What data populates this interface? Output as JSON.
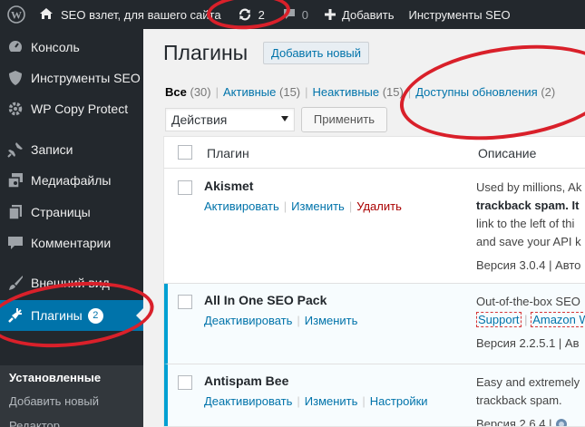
{
  "adminbar": {
    "site_name": "SEO взлет, для вашего сайта",
    "updates_count": "2",
    "comments_count": "0",
    "add_new_label": "Добавить",
    "seo_tools_label": "Инструменты SEO"
  },
  "sidebar": {
    "items": [
      {
        "label": "Консоль",
        "icon": "dashboard-icon"
      },
      {
        "label": "Инструменты SEO",
        "icon": "shield-icon"
      },
      {
        "label": "WP Copy Protect",
        "icon": "gear-icon"
      },
      {
        "label": "Записи",
        "icon": "pin-icon"
      },
      {
        "label": "Медиафайлы",
        "icon": "media-icon"
      },
      {
        "label": "Страницы",
        "icon": "pages-icon"
      },
      {
        "label": "Комментарии",
        "icon": "comment-icon"
      },
      {
        "label": "Внешний вид",
        "icon": "brush-icon"
      },
      {
        "label": "Плагины",
        "icon": "plug-icon",
        "badge": "2"
      }
    ],
    "submenu": [
      "Установленные",
      "Добавить новый",
      "Редактор"
    ]
  },
  "main": {
    "title": "Плагины",
    "add_new": "Добавить новый",
    "filters": [
      {
        "label": "Все",
        "count": "(30)"
      },
      {
        "label": "Активные",
        "count": "(15)"
      },
      {
        "label": "Неактивные",
        "count": "(15)"
      },
      {
        "label": "Доступны обновления",
        "count": "(2)"
      }
    ],
    "bulk_action": "Действия",
    "apply": "Применить",
    "columns": {
      "plugin": "Плагин",
      "description": "Описание"
    },
    "plugins": [
      {
        "name": "Akismet",
        "actions": [
          "Активировать",
          "Изменить",
          "Удалить"
        ],
        "desc_lines": [
          "Used by millions, Ak",
          "trackback spam. It",
          "link to the left of thi",
          "and save your API k"
        ],
        "desc_bold": "trackback spam.",
        "version": "Версия 3.0.4 | Авто"
      },
      {
        "name": "All In One SEO Pack",
        "actions": [
          "Деактивировать",
          "Изменить"
        ],
        "desc_lines": [
          "Out-of-the-box SEO"
        ],
        "links": [
          "Support",
          "Amazon W"
        ],
        "version": "Версия 2.2.5.1 | Ав"
      },
      {
        "name": "Antispam Bee",
        "actions": [
          "Деактивировать",
          "Изменить",
          "Настройки"
        ],
        "desc_lines": [
          "Easy and extremely",
          "trackback spam."
        ],
        "version": "Версия 2.6.4 |"
      }
    ]
  },
  "colors": {
    "adminbar_bg": "#23282d",
    "sidebar_bg": "#23282d",
    "accent": "#0073aa",
    "highlight": "#d9202a",
    "active_row_border": "#00a0d2"
  }
}
